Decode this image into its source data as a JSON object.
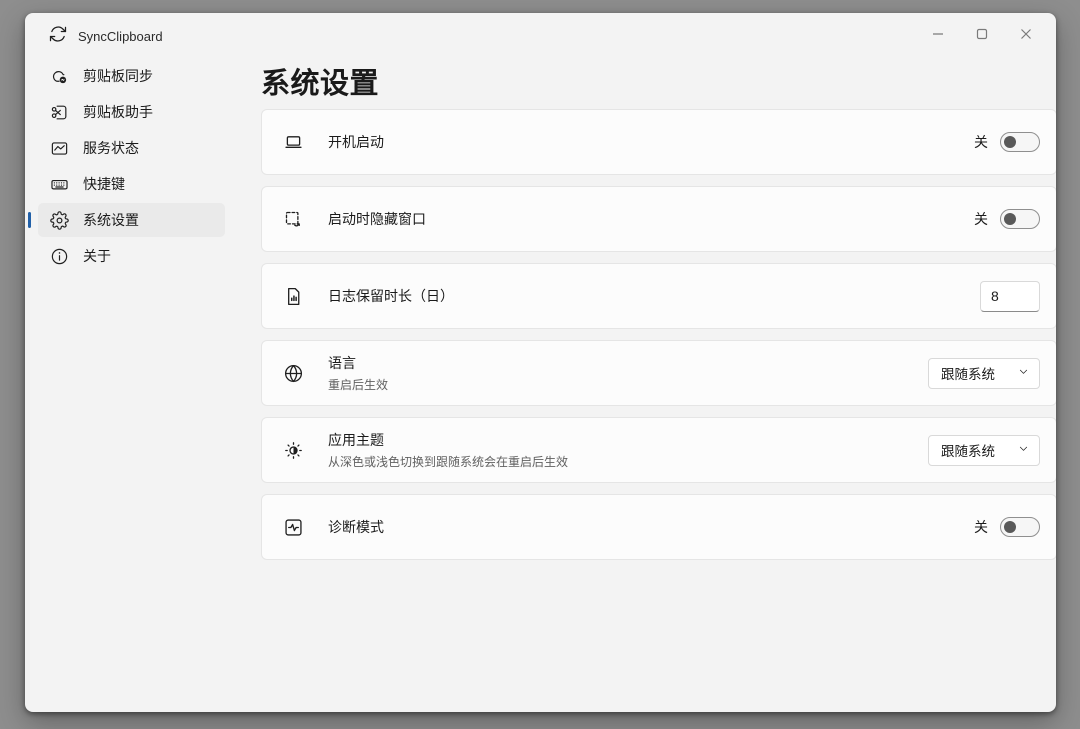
{
  "window": {
    "app_title": "SyncClipboard",
    "controls": {
      "minimize": "minimize",
      "maximize": "maximize",
      "close": "close"
    }
  },
  "colors": {
    "accent": "#2160a8",
    "window_bg": "#f3f3f3",
    "card_bg": "#fcfcfc",
    "desktop_bg": "#8e8e8e",
    "toggle_knob": "#595959"
  },
  "sidebar": {
    "items": [
      {
        "label": "剪贴板同步",
        "icon": "cloud-sync-icon",
        "selected": false
      },
      {
        "label": "剪贴板助手",
        "icon": "scissors-icon",
        "selected": false
      },
      {
        "label": "服务状态",
        "icon": "status-chart-icon",
        "selected": false
      },
      {
        "label": "快捷键",
        "icon": "keyboard-icon",
        "selected": false
      },
      {
        "label": "系统设置",
        "icon": "gear-icon",
        "selected": true
      },
      {
        "label": "关于",
        "icon": "info-icon",
        "selected": false
      }
    ]
  },
  "main": {
    "title": "系统设置",
    "settings": [
      {
        "label": "开机启动",
        "control": "toggle",
        "state_label": "关",
        "on": false,
        "icon": "laptop-icon"
      },
      {
        "label": "启动时隐藏窗口",
        "control": "toggle",
        "state_label": "关",
        "on": false,
        "icon": "hide-window-icon"
      },
      {
        "label": "日志保留时长（日）",
        "control": "input",
        "value": "8",
        "icon": "log-document-icon"
      },
      {
        "label": "语言",
        "subtitle": "重启后生效",
        "control": "select",
        "value": "跟随系统",
        "icon": "globe-icon"
      },
      {
        "label": "应用主题",
        "subtitle": "从深色或浅色切换到跟随系统会在重启后生效",
        "control": "select",
        "value": "跟随系统",
        "icon": "brightness-icon"
      },
      {
        "label": "诊断模式",
        "control": "toggle",
        "state_label": "关",
        "on": false,
        "icon": "pulse-icon"
      }
    ]
  }
}
